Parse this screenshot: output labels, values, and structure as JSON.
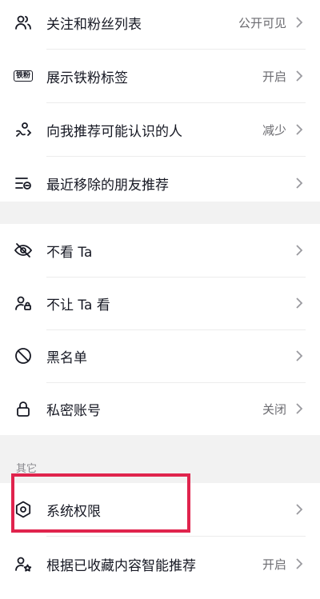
{
  "group1": {
    "items": [
      {
        "label": "关注和粉丝列表",
        "value": "公开可见",
        "icon": "followers-icon"
      },
      {
        "label": "展示铁粉标签",
        "value": "开启",
        "icon": "iron-fan-badge-icon",
        "badge_text": "铁粉"
      },
      {
        "label": "向我推荐可能认识的人",
        "value": "减少",
        "icon": "recommend-people-icon"
      },
      {
        "label": "最近移除的朋友推荐",
        "value": "",
        "icon": "removed-list-icon"
      }
    ]
  },
  "group2": {
    "items": [
      {
        "label": "不看 Ta",
        "value": "",
        "icon": "eye-off-icon"
      },
      {
        "label": "不让 Ta 看",
        "value": "",
        "icon": "user-lock-icon"
      },
      {
        "label": "黑名单",
        "value": "",
        "icon": "block-icon"
      },
      {
        "label": "私密账号",
        "value": "关闭",
        "icon": "lock-icon"
      }
    ]
  },
  "other_section": {
    "title": "其它",
    "items": [
      {
        "label": "系统权限",
        "value": "",
        "icon": "hexagon-settings-icon"
      },
      {
        "label": "根据已收藏内容智能推荐",
        "value": "开启",
        "icon": "user-star-icon"
      }
    ]
  },
  "colors": {
    "highlight": "#e0244d",
    "background": "#f2f2f2"
  }
}
